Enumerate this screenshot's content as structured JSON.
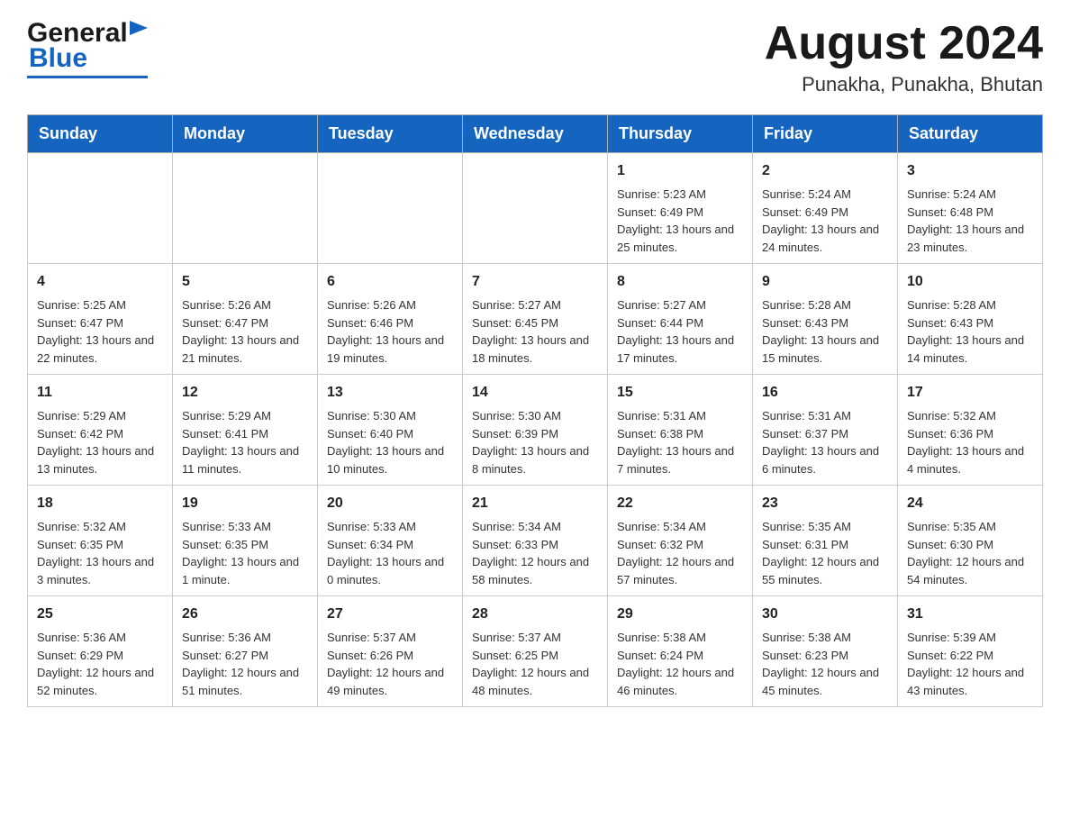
{
  "logo": {
    "general": "General",
    "triangle": "▶",
    "blue": "Blue"
  },
  "header": {
    "month_year": "August 2024",
    "location": "Punakha, Punakha, Bhutan"
  },
  "weekdays": [
    "Sunday",
    "Monday",
    "Tuesday",
    "Wednesday",
    "Thursday",
    "Friday",
    "Saturday"
  ],
  "weeks": [
    [
      {
        "day": "",
        "info": ""
      },
      {
        "day": "",
        "info": ""
      },
      {
        "day": "",
        "info": ""
      },
      {
        "day": "",
        "info": ""
      },
      {
        "day": "1",
        "info": "Sunrise: 5:23 AM\nSunset: 6:49 PM\nDaylight: 13 hours and 25 minutes."
      },
      {
        "day": "2",
        "info": "Sunrise: 5:24 AM\nSunset: 6:49 PM\nDaylight: 13 hours and 24 minutes."
      },
      {
        "day": "3",
        "info": "Sunrise: 5:24 AM\nSunset: 6:48 PM\nDaylight: 13 hours and 23 minutes."
      }
    ],
    [
      {
        "day": "4",
        "info": "Sunrise: 5:25 AM\nSunset: 6:47 PM\nDaylight: 13 hours and 22 minutes."
      },
      {
        "day": "5",
        "info": "Sunrise: 5:26 AM\nSunset: 6:47 PM\nDaylight: 13 hours and 21 minutes."
      },
      {
        "day": "6",
        "info": "Sunrise: 5:26 AM\nSunset: 6:46 PM\nDaylight: 13 hours and 19 minutes."
      },
      {
        "day": "7",
        "info": "Sunrise: 5:27 AM\nSunset: 6:45 PM\nDaylight: 13 hours and 18 minutes."
      },
      {
        "day": "8",
        "info": "Sunrise: 5:27 AM\nSunset: 6:44 PM\nDaylight: 13 hours and 17 minutes."
      },
      {
        "day": "9",
        "info": "Sunrise: 5:28 AM\nSunset: 6:43 PM\nDaylight: 13 hours and 15 minutes."
      },
      {
        "day": "10",
        "info": "Sunrise: 5:28 AM\nSunset: 6:43 PM\nDaylight: 13 hours and 14 minutes."
      }
    ],
    [
      {
        "day": "11",
        "info": "Sunrise: 5:29 AM\nSunset: 6:42 PM\nDaylight: 13 hours and 13 minutes."
      },
      {
        "day": "12",
        "info": "Sunrise: 5:29 AM\nSunset: 6:41 PM\nDaylight: 13 hours and 11 minutes."
      },
      {
        "day": "13",
        "info": "Sunrise: 5:30 AM\nSunset: 6:40 PM\nDaylight: 13 hours and 10 minutes."
      },
      {
        "day": "14",
        "info": "Sunrise: 5:30 AM\nSunset: 6:39 PM\nDaylight: 13 hours and 8 minutes."
      },
      {
        "day": "15",
        "info": "Sunrise: 5:31 AM\nSunset: 6:38 PM\nDaylight: 13 hours and 7 minutes."
      },
      {
        "day": "16",
        "info": "Sunrise: 5:31 AM\nSunset: 6:37 PM\nDaylight: 13 hours and 6 minutes."
      },
      {
        "day": "17",
        "info": "Sunrise: 5:32 AM\nSunset: 6:36 PM\nDaylight: 13 hours and 4 minutes."
      }
    ],
    [
      {
        "day": "18",
        "info": "Sunrise: 5:32 AM\nSunset: 6:35 PM\nDaylight: 13 hours and 3 minutes."
      },
      {
        "day": "19",
        "info": "Sunrise: 5:33 AM\nSunset: 6:35 PM\nDaylight: 13 hours and 1 minute."
      },
      {
        "day": "20",
        "info": "Sunrise: 5:33 AM\nSunset: 6:34 PM\nDaylight: 13 hours and 0 minutes."
      },
      {
        "day": "21",
        "info": "Sunrise: 5:34 AM\nSunset: 6:33 PM\nDaylight: 12 hours and 58 minutes."
      },
      {
        "day": "22",
        "info": "Sunrise: 5:34 AM\nSunset: 6:32 PM\nDaylight: 12 hours and 57 minutes."
      },
      {
        "day": "23",
        "info": "Sunrise: 5:35 AM\nSunset: 6:31 PM\nDaylight: 12 hours and 55 minutes."
      },
      {
        "day": "24",
        "info": "Sunrise: 5:35 AM\nSunset: 6:30 PM\nDaylight: 12 hours and 54 minutes."
      }
    ],
    [
      {
        "day": "25",
        "info": "Sunrise: 5:36 AM\nSunset: 6:29 PM\nDaylight: 12 hours and 52 minutes."
      },
      {
        "day": "26",
        "info": "Sunrise: 5:36 AM\nSunset: 6:27 PM\nDaylight: 12 hours and 51 minutes."
      },
      {
        "day": "27",
        "info": "Sunrise: 5:37 AM\nSunset: 6:26 PM\nDaylight: 12 hours and 49 minutes."
      },
      {
        "day": "28",
        "info": "Sunrise: 5:37 AM\nSunset: 6:25 PM\nDaylight: 12 hours and 48 minutes."
      },
      {
        "day": "29",
        "info": "Sunrise: 5:38 AM\nSunset: 6:24 PM\nDaylight: 12 hours and 46 minutes."
      },
      {
        "day": "30",
        "info": "Sunrise: 5:38 AM\nSunset: 6:23 PM\nDaylight: 12 hours and 45 minutes."
      },
      {
        "day": "31",
        "info": "Sunrise: 5:39 AM\nSunset: 6:22 PM\nDaylight: 12 hours and 43 minutes."
      }
    ]
  ]
}
